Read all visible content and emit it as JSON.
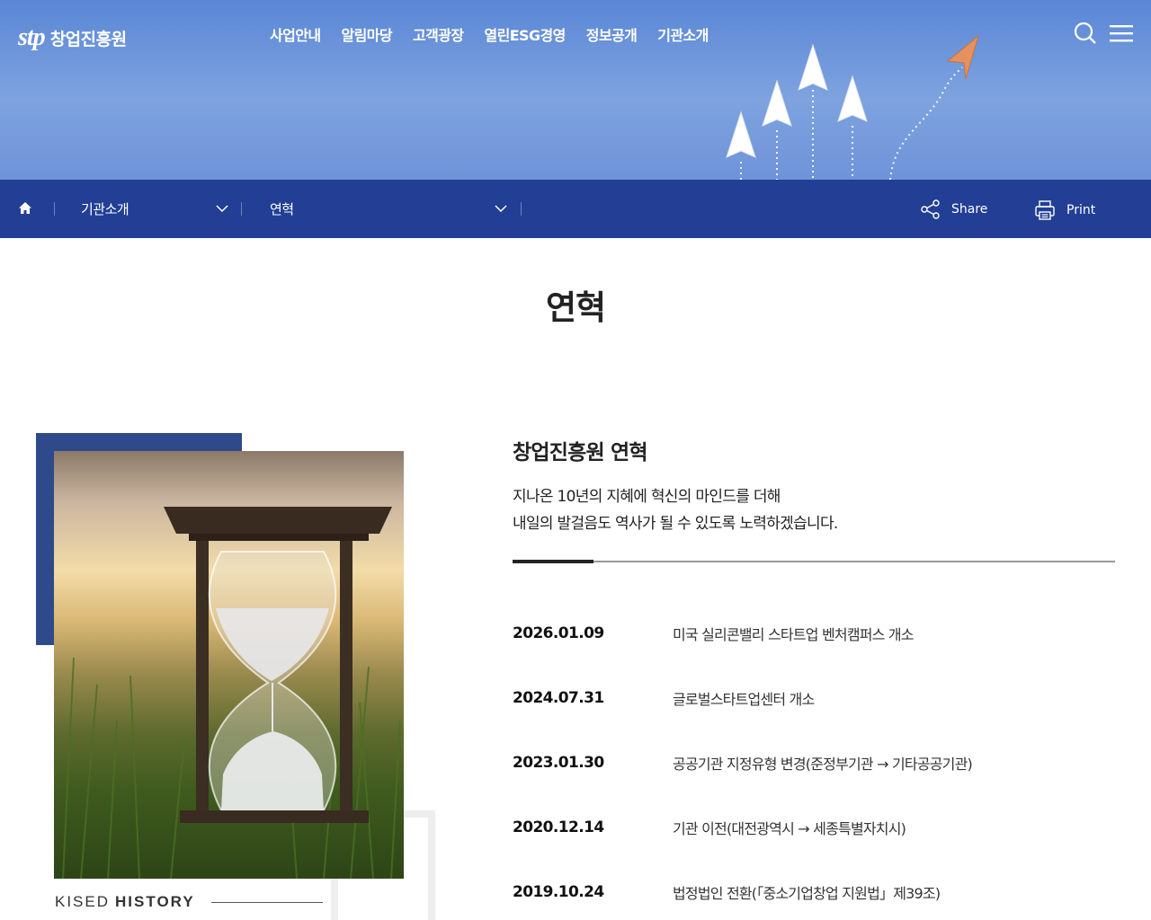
{
  "header": {
    "logo_mark": "stp",
    "logo_name": "창업진흥원",
    "nav": [
      "사업안내",
      "알림마당",
      "고객광장",
      "열린ESG경영",
      "정보공개",
      "기관소개"
    ],
    "icons": [
      "search-icon",
      "menu-icon"
    ]
  },
  "location": {
    "home_icon": "home-icon",
    "depth1": "기관소개",
    "depth2": "연혁",
    "share_label": "Share",
    "print_label": "Print"
  },
  "page": {
    "title": "연혁"
  },
  "intro": {
    "title": "창업진흥원 연혁",
    "desc_line1": "지나온 10년의 지혜에 혁신의 마인드를 더해",
    "desc_line2": "내일의 발걸음도 역사가 될 수 있도록 노력하겠습니다."
  },
  "caption": {
    "word1": "KISED",
    "word2": "HISTORY"
  },
  "timeline": [
    {
      "date": "2026.01.09",
      "text": "미국 실리콘밸리 스타트업 벤처캠퍼스 개소"
    },
    {
      "date": "2024.07.31",
      "text": "글로벌스타트업센터 개소"
    },
    {
      "date": "2023.01.30",
      "text": "공공기관 지정유형 변경(준정부기관 → 기타공공기관)"
    },
    {
      "date": "2020.12.14",
      "text": "기관 이전(대전광역시 → 세종특별자치시)"
    },
    {
      "date": "2019.10.24",
      "text": "법정법인 전환(「중소기업창업 지원법」제39조)"
    }
  ],
  "colors": {
    "locbar": "#223f95",
    "accent_block": "#2f4a8a"
  }
}
